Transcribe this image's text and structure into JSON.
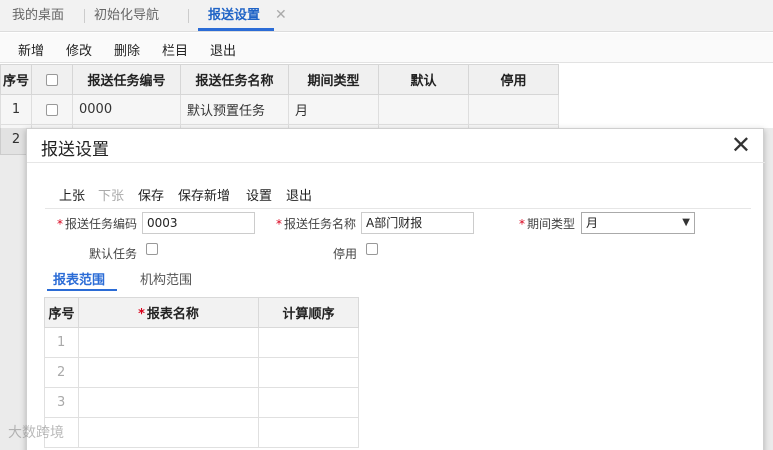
{
  "tabs": [
    {
      "label": "我的桌面"
    },
    {
      "label": "初始化导航"
    },
    {
      "label": "报送设置"
    }
  ],
  "toolbar": {
    "add": "新增",
    "edit": "修改",
    "delete": "删除",
    "columns": "栏目",
    "exit": "退出"
  },
  "grid": {
    "headers": [
      "序号",
      "",
      "报送任务编号",
      "报送任务名称",
      "期间类型",
      "默认",
      "停用"
    ],
    "rows": [
      {
        "idx": "1",
        "code": "0000",
        "name": "默认预置任务",
        "period": "月",
        "default": "",
        "disabled": ""
      },
      {
        "idx": "2",
        "code": "",
        "name": "",
        "period": "",
        "default": "",
        "disabled": ""
      }
    ]
  },
  "dialog": {
    "title": "报送设置",
    "toolbar": {
      "prev": "上张",
      "next": "下张",
      "save": "保存",
      "save_new": "保存新增",
      "settings": "设置",
      "exit": "退出"
    },
    "form": {
      "code_label": "报送任务编码",
      "code_value": "0003",
      "name_label": "报送任务名称",
      "name_value": "A部门财报",
      "period_label": "期间类型",
      "period_value": "月",
      "default_label": "默认任务",
      "disabled_label": "停用",
      "required_mark": "*"
    },
    "subtabs": {
      "report_scope": "报表范围",
      "org_scope": "机构范围"
    },
    "table": {
      "headers": {
        "idx": "序号",
        "name": "报表名称",
        "order": "计算顺序"
      },
      "rows": [
        "1",
        "2",
        "3",
        ""
      ]
    }
  },
  "watermark": "大数跨境",
  "colors": {
    "accent": "#2b6cd6",
    "required": "#d9001b"
  }
}
